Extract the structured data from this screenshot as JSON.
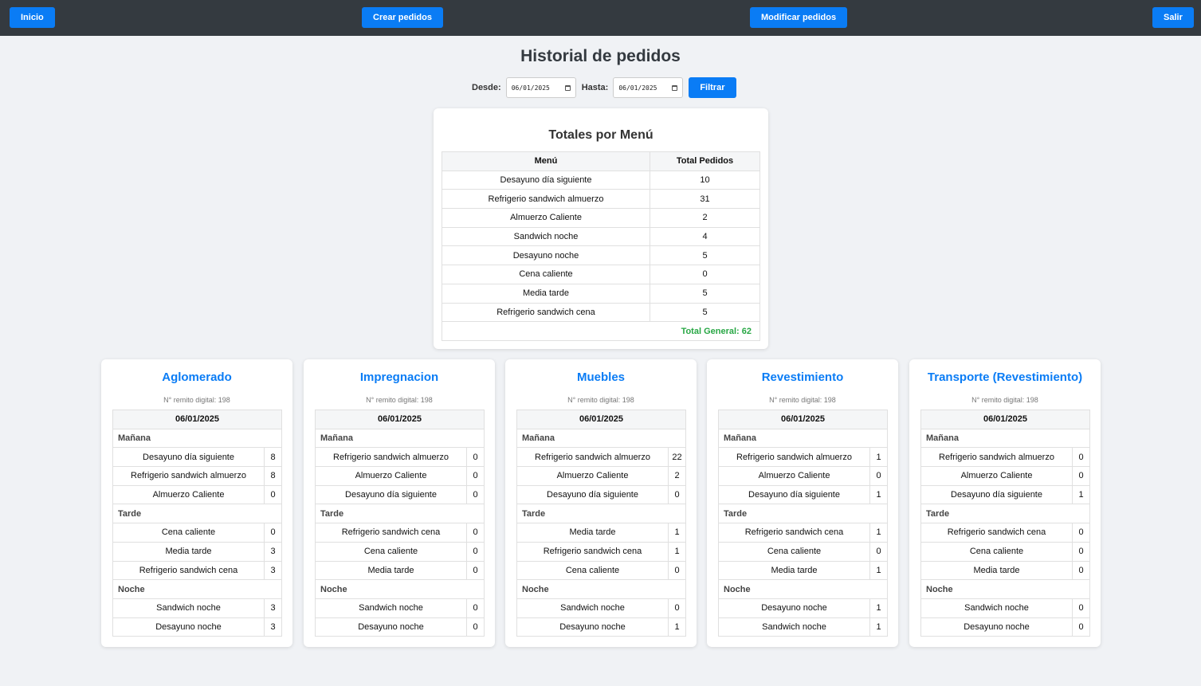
{
  "nav": {
    "inicio": "Inicio",
    "crear": "Crear pedidos",
    "modificar": "Modificar pedidos",
    "salir": "Salir"
  },
  "page_title": "Historial de pedidos",
  "filter": {
    "desde_label": "Desde:",
    "desde_value": "06/01/2025",
    "hasta_label": "Hasta:",
    "hasta_value": "06/01/2025",
    "button": "Filtrar"
  },
  "totals": {
    "title": "Totales por Menú",
    "headers": [
      "Menú",
      "Total Pedidos"
    ],
    "rows": [
      {
        "menu": "Desayuno día siguiente",
        "total": "10"
      },
      {
        "menu": "Refrigerio sandwich almuerzo",
        "total": "31"
      },
      {
        "menu": "Almuerzo Caliente",
        "total": "2"
      },
      {
        "menu": "Sandwich noche",
        "total": "4"
      },
      {
        "menu": "Desayuno noche",
        "total": "5"
      },
      {
        "menu": "Cena caliente",
        "total": "0"
      },
      {
        "menu": "Media tarde",
        "total": "5"
      },
      {
        "menu": "Refrigerio sandwich cena",
        "total": "5"
      }
    ],
    "grand_total": "Total General: 62"
  },
  "areas": [
    {
      "name": "Aglomerado",
      "remito": "N° remito digital: 198",
      "date": "06/01/2025",
      "shifts": [
        {
          "name": "Mañana",
          "items": [
            [
              "Desayuno día siguiente",
              "8"
            ],
            [
              "Refrigerio sandwich almuerzo",
              "8"
            ],
            [
              "Almuerzo Caliente",
              "0"
            ]
          ]
        },
        {
          "name": "Tarde",
          "items": [
            [
              "Cena caliente",
              "0"
            ],
            [
              "Media tarde",
              "3"
            ],
            [
              "Refrigerio sandwich cena",
              "3"
            ]
          ]
        },
        {
          "name": "Noche",
          "items": [
            [
              "Sandwich noche",
              "3"
            ],
            [
              "Desayuno noche",
              "3"
            ]
          ]
        }
      ]
    },
    {
      "name": "Impregnacion",
      "remito": "N° remito digital: 198",
      "date": "06/01/2025",
      "shifts": [
        {
          "name": "Mañana",
          "items": [
            [
              "Refrigerio sandwich almuerzo",
              "0"
            ],
            [
              "Almuerzo Caliente",
              "0"
            ],
            [
              "Desayuno día siguiente",
              "0"
            ]
          ]
        },
        {
          "name": "Tarde",
          "items": [
            [
              "Refrigerio sandwich cena",
              "0"
            ],
            [
              "Cena caliente",
              "0"
            ],
            [
              "Media tarde",
              "0"
            ]
          ]
        },
        {
          "name": "Noche",
          "items": [
            [
              "Sandwich noche",
              "0"
            ],
            [
              "Desayuno noche",
              "0"
            ]
          ]
        }
      ]
    },
    {
      "name": "Muebles",
      "remito": "N° remito digital: 198",
      "date": "06/01/2025",
      "shifts": [
        {
          "name": "Mañana",
          "items": [
            [
              "Refrigerio sandwich almuerzo",
              "22"
            ],
            [
              "Almuerzo Caliente",
              "2"
            ],
            [
              "Desayuno día siguiente",
              "0"
            ]
          ]
        },
        {
          "name": "Tarde",
          "items": [
            [
              "Media tarde",
              "1"
            ],
            [
              "Refrigerio sandwich cena",
              "1"
            ],
            [
              "Cena caliente",
              "0"
            ]
          ]
        },
        {
          "name": "Noche",
          "items": [
            [
              "Sandwich noche",
              "0"
            ],
            [
              "Desayuno noche",
              "1"
            ]
          ]
        }
      ]
    },
    {
      "name": "Revestimiento",
      "remito": "N° remito digital: 198",
      "date": "06/01/2025",
      "shifts": [
        {
          "name": "Mañana",
          "items": [
            [
              "Refrigerio sandwich almuerzo",
              "1"
            ],
            [
              "Almuerzo Caliente",
              "0"
            ],
            [
              "Desayuno día siguiente",
              "1"
            ]
          ]
        },
        {
          "name": "Tarde",
          "items": [
            [
              "Refrigerio sandwich cena",
              "1"
            ],
            [
              "Cena caliente",
              "0"
            ],
            [
              "Media tarde",
              "1"
            ]
          ]
        },
        {
          "name": "Noche",
          "items": [
            [
              "Desayuno noche",
              "1"
            ],
            [
              "Sandwich noche",
              "1"
            ]
          ]
        }
      ]
    },
    {
      "name": "Transporte (Revestimiento)",
      "remito": "N° remito digital: 198",
      "date": "06/01/2025",
      "shifts": [
        {
          "name": "Mañana",
          "items": [
            [
              "Refrigerio sandwich almuerzo",
              "0"
            ],
            [
              "Almuerzo Caliente",
              "0"
            ],
            [
              "Desayuno día siguiente",
              "1"
            ]
          ]
        },
        {
          "name": "Tarde",
          "items": [
            [
              "Refrigerio sandwich cena",
              "0"
            ],
            [
              "Cena caliente",
              "0"
            ],
            [
              "Media tarde",
              "0"
            ]
          ]
        },
        {
          "name": "Noche",
          "items": [
            [
              "Sandwich noche",
              "0"
            ],
            [
              "Desayuno noche",
              "0"
            ]
          ]
        }
      ]
    }
  ]
}
